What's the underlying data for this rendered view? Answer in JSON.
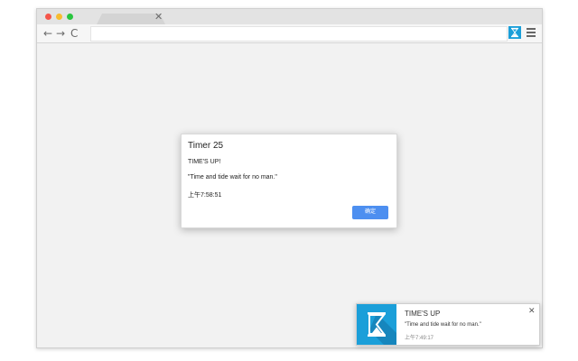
{
  "browser": {
    "tab_close_glyph": "✕",
    "back_glyph": "←",
    "forward_glyph": "→",
    "reload_glyph": "C",
    "extension_icon": "hourglass-icon",
    "menu_icon": "hamburger-menu-icon",
    "traffic_light_colors": [
      "#f5554a",
      "#f7bc2f",
      "#29c53f"
    ]
  },
  "dialog": {
    "title": "Timer 25",
    "line1": "TIME'S UP!",
    "line2": "\"Time and tide wait for no man.\"",
    "line3": "上午7:58:51",
    "ok_label": "确定",
    "ok_color": "#4d8ff0"
  },
  "notification": {
    "icon": "hourglass-icon",
    "icon_bg": "#1b9fd9",
    "title": "TIME'S UP",
    "message": "\"Time and tide wait for no man.\"",
    "time": "上午7:49:17",
    "close_glyph": "✕"
  }
}
